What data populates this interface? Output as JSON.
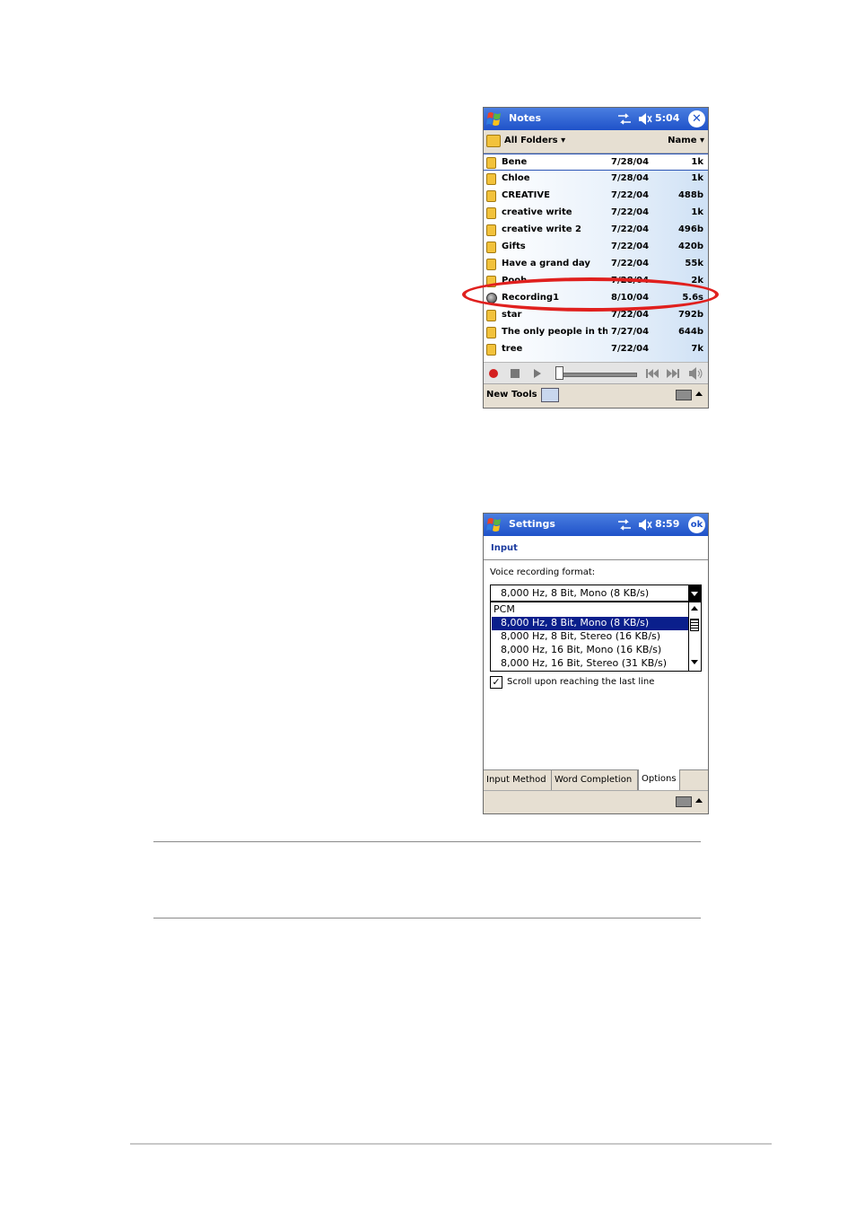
{
  "notes_screen": {
    "title": "Notes",
    "time": "5:04",
    "folder_label": "All Folders",
    "sort_label": "Name",
    "files": [
      {
        "name": "Bene",
        "date": "7/28/04",
        "size": "1k",
        "type": "folder"
      },
      {
        "name": "Chloe",
        "date": "7/28/04",
        "size": "1k",
        "type": "folder"
      },
      {
        "name": "CREATIVE",
        "date": "7/22/04",
        "size": "488b",
        "type": "folder"
      },
      {
        "name": "creative write",
        "date": "7/22/04",
        "size": "1k",
        "type": "folder"
      },
      {
        "name": "creative write 2",
        "date": "7/22/04",
        "size": "496b",
        "type": "folder"
      },
      {
        "name": "Gifts",
        "date": "7/22/04",
        "size": "420b",
        "type": "folder"
      },
      {
        "name": "Have a grand day",
        "date": "7/22/04",
        "size": "55k",
        "type": "folder"
      },
      {
        "name": "Pooh",
        "date": "7/28/04",
        "size": "2k",
        "type": "folder"
      },
      {
        "name": "Recording1",
        "date": "8/10/04",
        "size": "5.6s",
        "type": "recording"
      },
      {
        "name": "star",
        "date": "7/22/04",
        "size": "792b",
        "type": "folder"
      },
      {
        "name": "The only people in th",
        "date": "7/27/04",
        "size": "644b",
        "type": "folder"
      },
      {
        "name": "tree",
        "date": "7/22/04",
        "size": "7k",
        "type": "folder"
      }
    ],
    "menu_new": "New",
    "menu_tools": "Tools",
    "highlight_color": "#e0201e"
  },
  "settings_screen": {
    "title": "Settings",
    "time": "8:59",
    "ok_label": "ok",
    "section": "Input",
    "field_label": "Voice recording format:",
    "selected_value": "8,000 Hz, 8 Bit, Mono (8 KB/s)",
    "options": [
      "PCM",
      "8,000 Hz, 8 Bit, Mono (8 KB/s)",
      "8,000 Hz, 8 Bit, Stereo (16 KB/s)",
      "8,000 Hz, 16 Bit, Mono (16 KB/s)",
      "8,000 Hz, 16 Bit, Stereo (31 KB/s)"
    ],
    "checkbox_label": "Scroll upon reaching the last line",
    "checkbox_checked": true,
    "tabs": [
      "Input Method",
      "Word Completion",
      "Options"
    ],
    "active_tab": "Options"
  },
  "colors": {
    "titlebar": "#1f52c9",
    "selection": "#0a1f8c"
  }
}
